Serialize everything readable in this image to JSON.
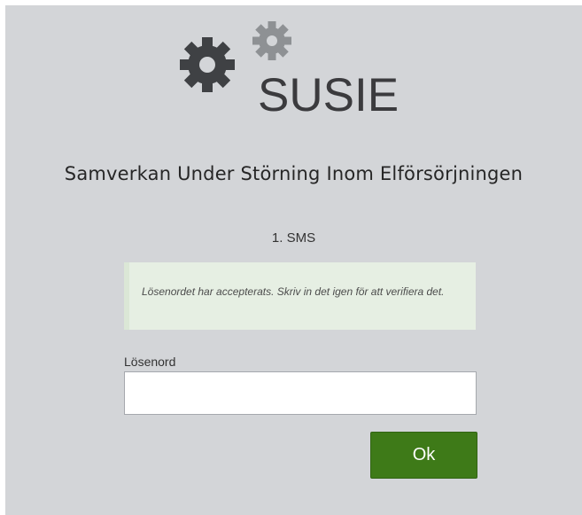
{
  "logo": {
    "text": "SUSIE",
    "icon": "gears-icon",
    "colors": {
      "big_gear": "#3f4144",
      "small_gear": "#8e9194"
    }
  },
  "page": {
    "title": "Samverkan Under Störning Inom Elförsörjningen",
    "step": "1. SMS"
  },
  "alert": {
    "message": "Lösenordet har accepterats. Skriv in det igen för att verifiera det.",
    "background": "#e6efe3"
  },
  "form": {
    "password_label": "Lösenord",
    "password_value": "",
    "submit_label": "Ok",
    "submit_color": "#3e7a18"
  }
}
